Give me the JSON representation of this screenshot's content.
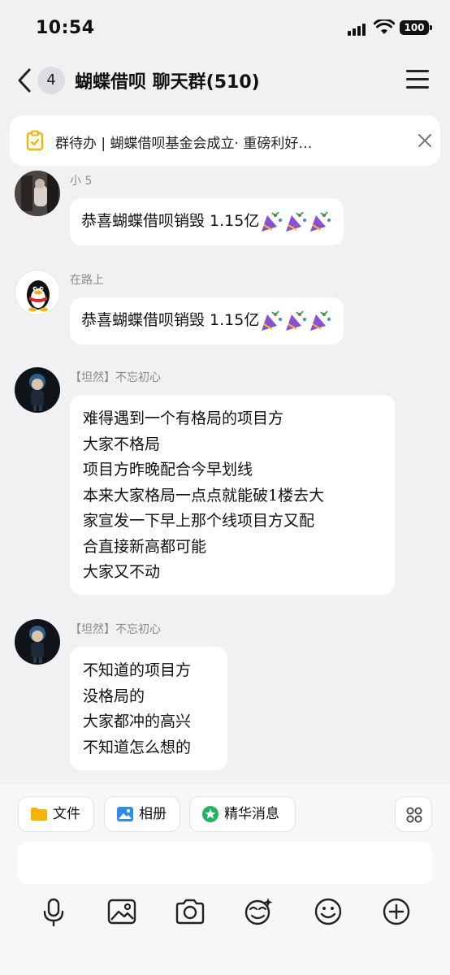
{
  "status": {
    "time": "10:54",
    "battery": "100"
  },
  "header": {
    "unread_count": "4",
    "title": "蝴蝶借呗 聊天群(510)"
  },
  "todo_banner": {
    "text": "群待办 | 蝴蝶借呗基金会成立·   重磅利好…"
  },
  "messages": [
    {
      "sender": "小 5",
      "text": "恭喜蝴蝶借呗销毁 1.15亿",
      "emoji": "party-popper-x3"
    },
    {
      "sender": "在路上",
      "text": "恭喜蝴蝶借呗销毁 1.15亿",
      "emoji": "party-popper-x3"
    },
    {
      "sender": "【坦然】不忘初心",
      "lines": [
        "难得遇到一个有格局的项目方",
        "大家不格局",
        "项目方昨晚配合今早划线",
        "本来大家格局一点点就能破1楼去大",
        "家宣发一下早上那个线项目方又配",
        "合直接新高都可能",
        "大家又不动"
      ]
    },
    {
      "sender": "【坦然】不忘初心",
      "lines": [
        "不知道的项目方",
        "没格局的",
        "大家都冲的高兴",
        "不知道怎么想的"
      ]
    }
  ],
  "shortcuts": [
    {
      "label": "文件",
      "icon": "folder-icon"
    },
    {
      "label": "相册",
      "icon": "image-icon"
    },
    {
      "label": "精华消息",
      "icon": "star-icon"
    }
  ],
  "toolbar_icons": [
    "microphone-icon",
    "picture-icon",
    "camera-icon",
    "sticker-icon",
    "emoji-icon",
    "plus-icon"
  ],
  "colors": {
    "background": "#f1f1f3",
    "bubble": "#ffffff",
    "accent_green": "#1fb55c",
    "folder_yellow": "#f5b400",
    "album_blue": "#2d8cf0"
  }
}
